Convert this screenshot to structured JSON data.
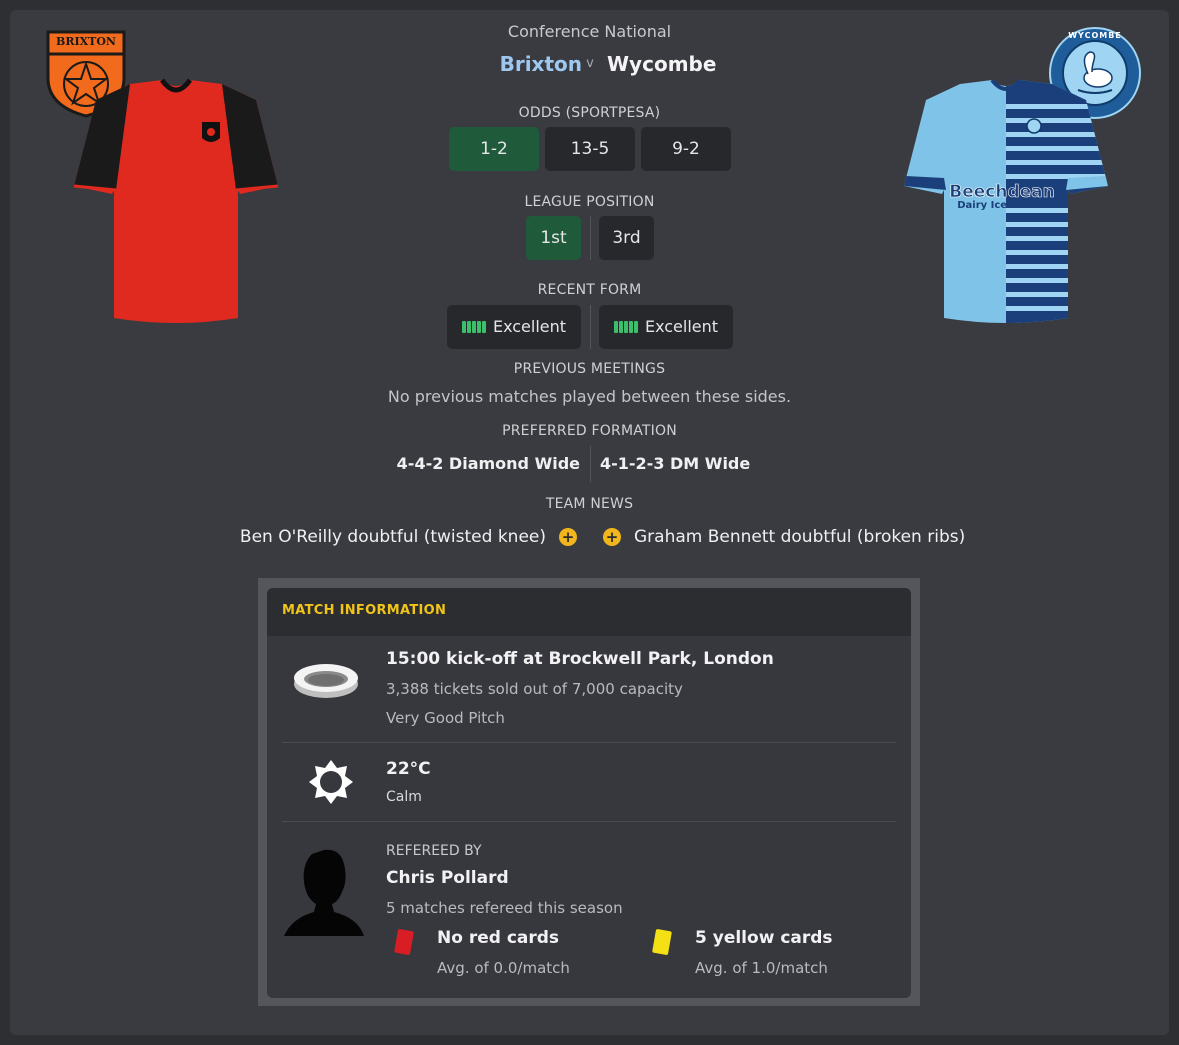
{
  "header": {
    "competition": "Conference National",
    "home_team": "Brixton",
    "versus": "v",
    "away_team": "Wycombe",
    "home_crest_text": "BRIXTON",
    "away_crest_text": "WYCOMBE"
  },
  "odds": {
    "label": "ODDS (SPORTPESA)",
    "home": "1-2",
    "draw": "13-5",
    "away": "9-2"
  },
  "league_position": {
    "label": "LEAGUE POSITION",
    "home": "1st",
    "away": "3rd"
  },
  "recent_form": {
    "label": "RECENT FORM",
    "home": "Excellent",
    "away": "Excellent"
  },
  "previous_meetings": {
    "label": "PREVIOUS MEETINGS",
    "text": "No previous matches played between these sides."
  },
  "preferred_formation": {
    "label": "PREFERRED FORMATION",
    "home": "4-4-2 Diamond Wide",
    "away": "4-1-2-3 DM Wide"
  },
  "team_news": {
    "label": "TEAM NEWS",
    "home": "Ben O'Reilly doubtful (twisted knee)",
    "away": "Graham Bennett doubtful (broken ribs)"
  },
  "match_info": {
    "title": "MATCH INFORMATION",
    "venue": {
      "kickoff": "15:00 kick-off at Brockwell Park, London",
      "tickets": "3,388 tickets sold out of 7,000 capacity",
      "pitch": "Very Good Pitch"
    },
    "weather": {
      "temperature": "22°C",
      "condition": "Calm"
    },
    "referee": {
      "label": "REFEREED BY",
      "name": "Chris Pollard",
      "matches": "5 matches refereed this season",
      "red_cards": "No red cards",
      "red_avg": "Avg. of 0.0/match",
      "yellow_cards": "5 yellow cards",
      "yellow_avg": "Avg. of 1.0/match"
    }
  },
  "colors": {
    "accent_green": "#1f5a3a",
    "form_green": "#3bbf6a",
    "home_blue": "#9ec8f0",
    "header_gold": "#f0c419",
    "plus_yellow": "#f2b61d"
  }
}
